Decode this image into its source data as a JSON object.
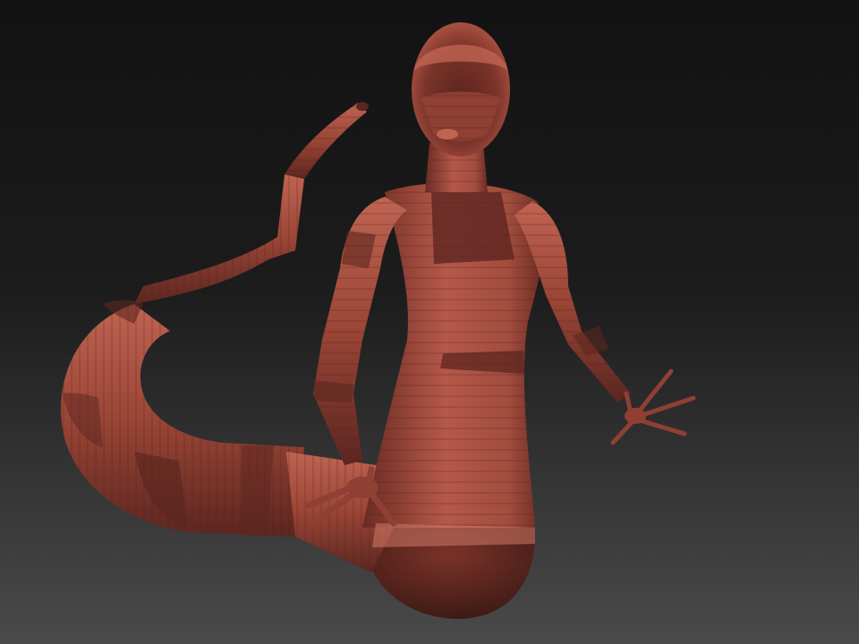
{
  "scene": {
    "subject": "sculpted-figure",
    "colors": {
      "background_top": "#121212",
      "background_bottom": "#4a4a4a",
      "skin_light": "#b55848",
      "skin_mid": "#8f3f33",
      "skin_dark": "#5c2620",
      "skin_highlight": "#d27a68"
    }
  }
}
